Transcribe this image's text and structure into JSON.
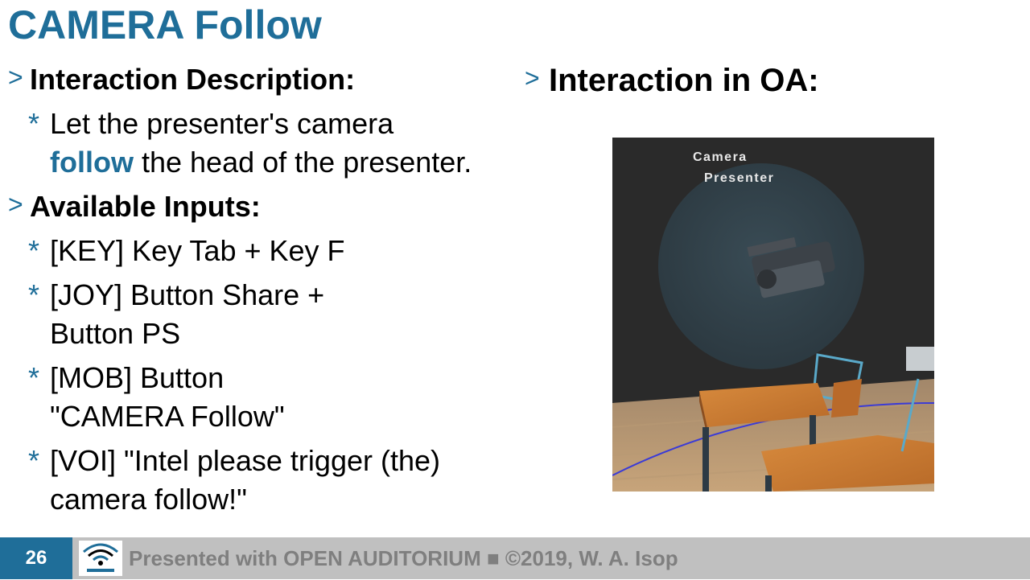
{
  "slide": {
    "title": "CAMERA Follow",
    "left": {
      "arrow": ">",
      "bullet": "*",
      "heading1": "Interaction Description:",
      "desc_line1": "Let the presenter's camera",
      "desc_highlight": "follow",
      "desc_rest": " the head of the presenter.",
      "heading2": "Available Inputs:",
      "inputs": [
        "[KEY] Key Tab + Key F",
        "[JOY] Button Share + Button PS",
        "[MOB] Button \"CAMERA Follow\"",
        "[VOI] \"Intel please trigger (the) camera follow!\""
      ],
      "inputs_lines": [
        [
          "[KEY] Key Tab + Key F"
        ],
        [
          "[JOY] Button Share +",
          "Button PS"
        ],
        [
          "[MOB] Button",
          "\"CAMERA Follow\""
        ],
        [
          "[VOI] \"Intel please trigger (the)",
          "camera follow!\""
        ]
      ]
    },
    "right": {
      "heading": "Interaction in OA:",
      "scene_labels": {
        "camera": "Camera",
        "presenter": "Presenter"
      }
    }
  },
  "footer": {
    "page_number": "26",
    "text": "Presented with OPEN AUDITORIUM ■ ©2019, W. A. Isop",
    "logo_icon": "open-auditorium-wifi-logo",
    "colors": {
      "accent": "#1f6e99",
      "bar": "#c0c0c0",
      "text": "#7f7f7f"
    }
  }
}
